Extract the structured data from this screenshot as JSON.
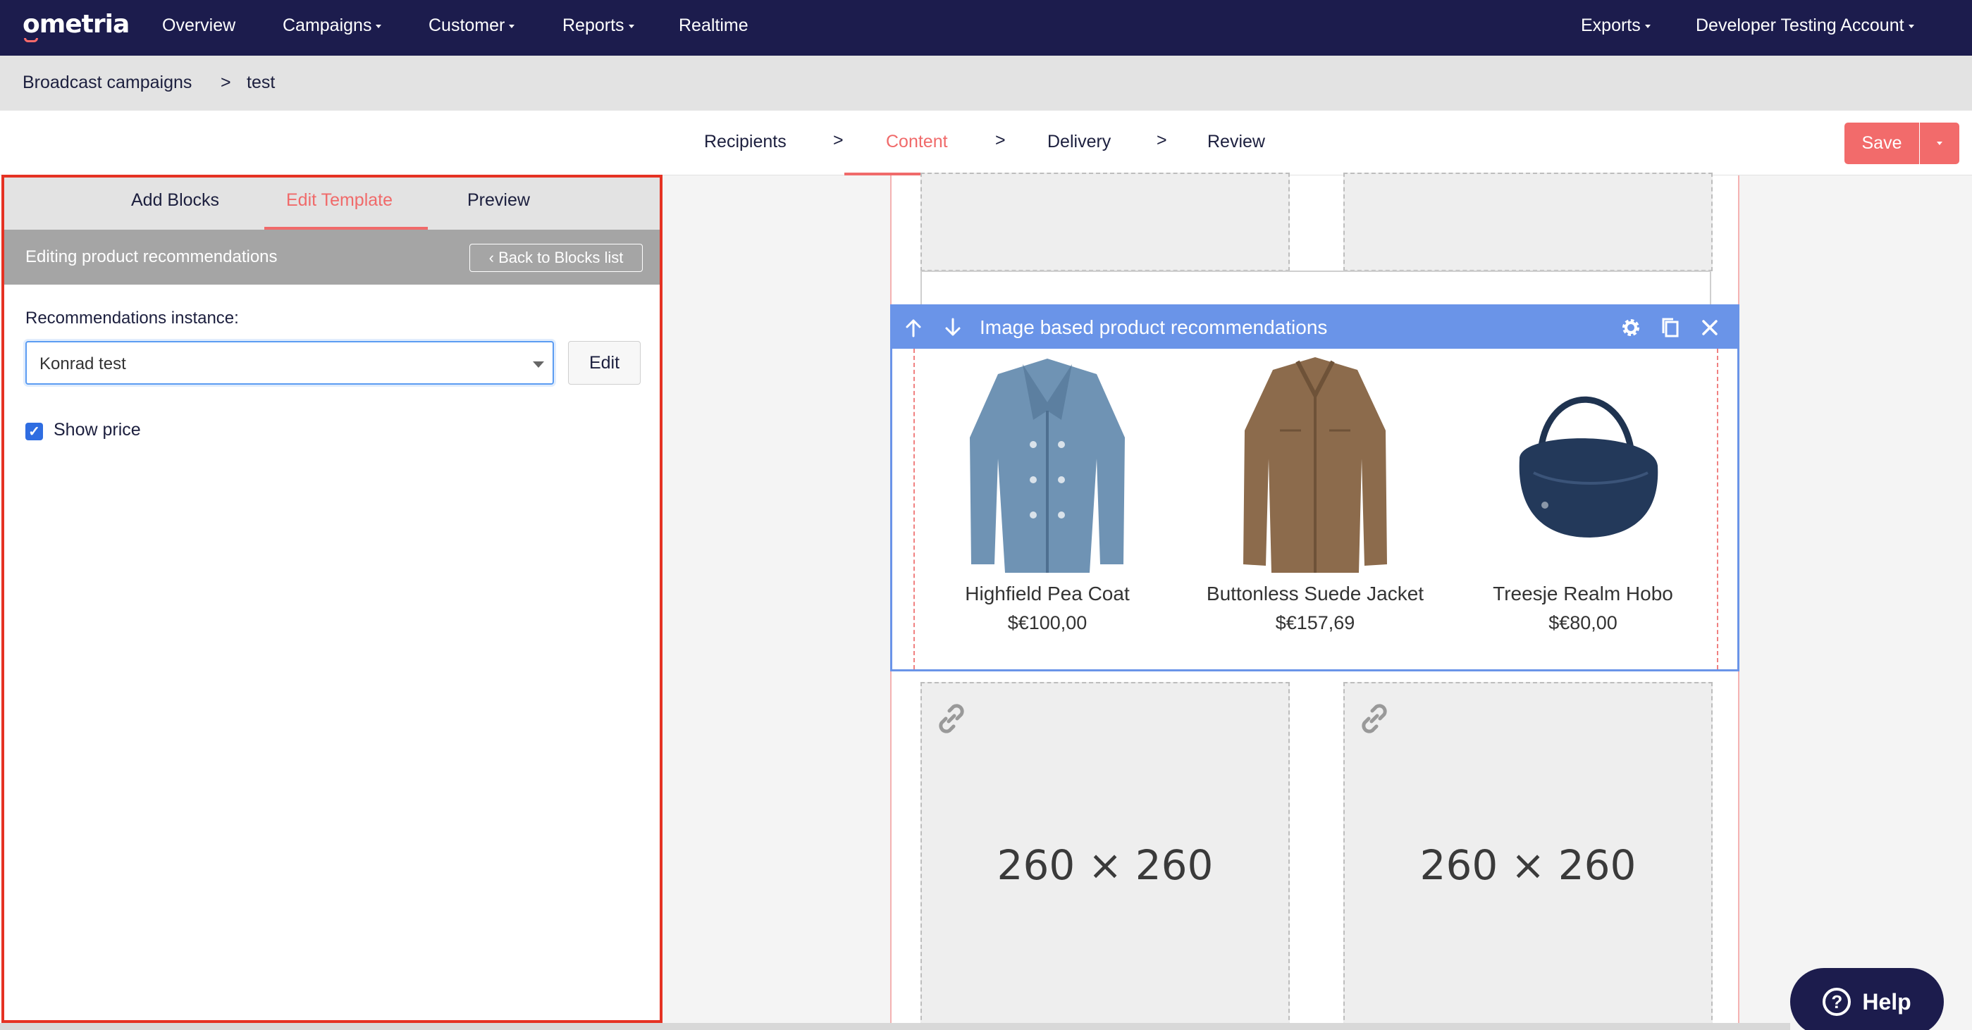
{
  "app": {
    "logo": "ometria",
    "nav": [
      {
        "label": "Overview",
        "dropdown": false
      },
      {
        "label": "Campaigns",
        "dropdown": true
      },
      {
        "label": "Customer",
        "dropdown": true
      },
      {
        "label": "Reports",
        "dropdown": true
      },
      {
        "label": "Realtime",
        "dropdown": false
      }
    ],
    "nav_right": [
      {
        "label": "Exports",
        "dropdown": true
      },
      {
        "label": "Developer Testing Account",
        "dropdown": true
      }
    ]
  },
  "breadcrumb": {
    "parent": "Broadcast campaigns",
    "separator": ">",
    "current": "test"
  },
  "steps": {
    "items": [
      "Recipients",
      "Content",
      "Delivery",
      "Review"
    ],
    "active": "Content",
    "separator": ">",
    "save_label": "Save"
  },
  "left_panel": {
    "tabs": [
      "Add Blocks",
      "Edit Template",
      "Preview"
    ],
    "active_tab": "Edit Template",
    "editing_title": "Editing product recommendations",
    "back_label": "‹ Back to Blocks list",
    "instance_label": "Recommendations instance:",
    "instance_value": "Konrad test",
    "edit_label": "Edit",
    "show_price_label": "Show price",
    "show_price_checked": true
  },
  "canvas": {
    "block_title": "Image based product recommendations",
    "products": [
      {
        "name": "Highfield Pea Coat",
        "price": "$€100,00"
      },
      {
        "name": "Buttonless Suede Jacket",
        "price": "$€157,69"
      },
      {
        "name": "Treesje Realm Hobo",
        "price": "$€80,00"
      }
    ],
    "placeholder_text": "260 × 260"
  },
  "help": {
    "label": "Help"
  },
  "colors": {
    "nav_bg": "#1c1c4d",
    "accent": "#f06a6a",
    "block_header": "#6a94e8",
    "panel_border": "#e53223"
  }
}
